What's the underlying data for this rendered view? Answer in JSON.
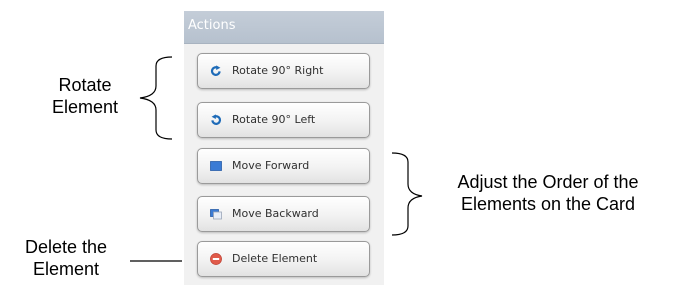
{
  "panel": {
    "title": "Actions",
    "buttons": [
      {
        "label": "Rotate 90° Right",
        "icon": "rotate-right-icon"
      },
      {
        "label": "Rotate 90° Left",
        "icon": "rotate-left-icon"
      },
      {
        "label": "Move Forward",
        "icon": "move-forward-icon"
      },
      {
        "label": "Move Backward",
        "icon": "move-backward-icon"
      },
      {
        "label": "Delete Element",
        "icon": "delete-icon"
      }
    ]
  },
  "annotations": {
    "rotate": [
      "Rotate",
      "Element"
    ],
    "order": [
      "Adjust the Order of the",
      "Elements on the Card"
    ],
    "delete": [
      "Delete the",
      "Element"
    ]
  },
  "colors": {
    "header": "#b8c3d0",
    "rotate_icon": "#1e6bb8",
    "forward_icon": "#3a7bd5",
    "delete_icon": "#e05a4a"
  }
}
